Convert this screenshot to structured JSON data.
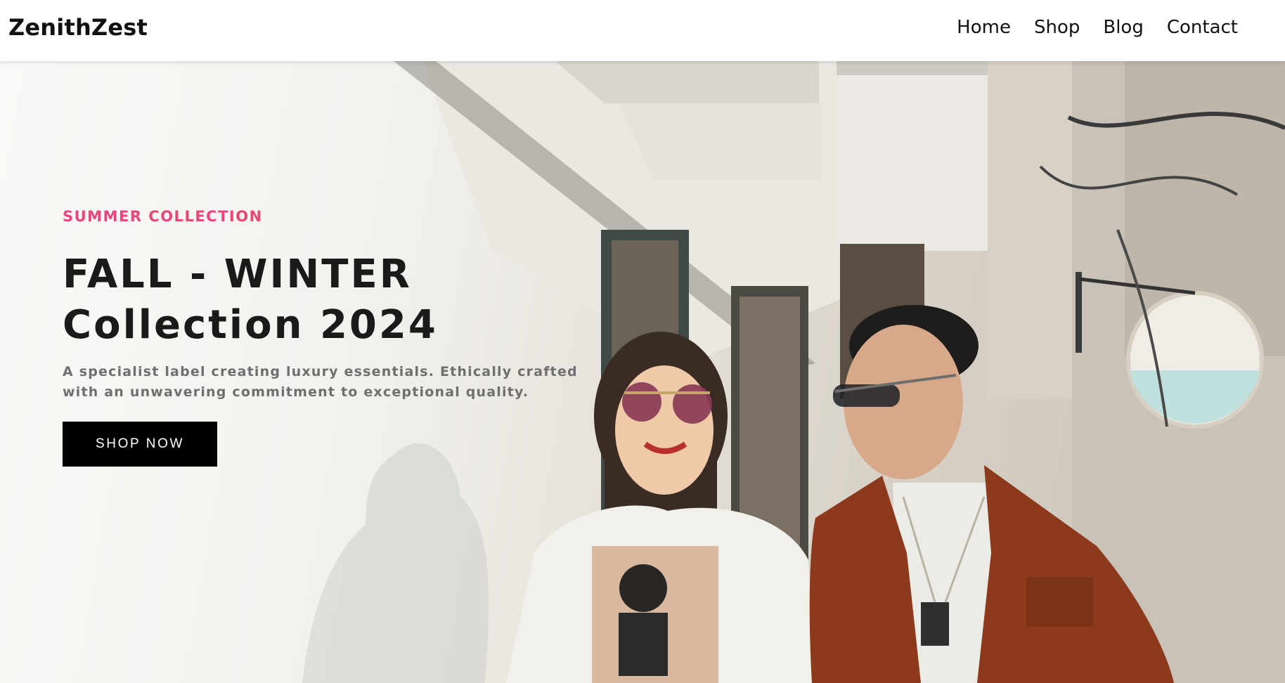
{
  "brand": {
    "name": "ZenithZest"
  },
  "nav": {
    "items": [
      {
        "label": "Home"
      },
      {
        "label": "Shop"
      },
      {
        "label": "Blog"
      },
      {
        "label": "Contact"
      }
    ]
  },
  "hero": {
    "kicker": "SUMMER COLLECTION",
    "title_line1": "FALL - WINTER",
    "title_line2": "Collection 2024",
    "description": "A specialist label creating luxury essentials. Ethically crafted with an unwavering commitment to exceptional quality.",
    "cta_label": "SHOP NOW",
    "image_semantic": "fashion-photo-couple-sunglasses"
  },
  "colors": {
    "accent": "#e8457a",
    "text_dark": "#1a1a1a",
    "text_muted": "#6f6f6f",
    "button_bg": "#000000",
    "button_text": "#ffffff"
  }
}
